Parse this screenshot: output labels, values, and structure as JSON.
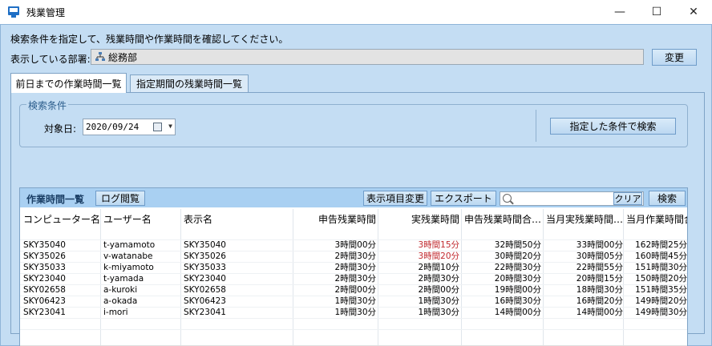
{
  "window": {
    "title": "残業管理",
    "minimize": "—",
    "maximize": "☐",
    "close": "✕"
  },
  "instruction": "検索条件を指定して、残業時間や作業時間を確認してください。",
  "dept": {
    "label": "表示している部署:",
    "value": "総務部",
    "change_button": "変更"
  },
  "tabs": [
    {
      "label": "前日までの作業時間一覧"
    },
    {
      "label": "指定期間の残業時間一覧"
    }
  ],
  "criteria": {
    "legend": "検索条件",
    "date_label": "対象日:",
    "date_value": "2020/09/24",
    "search_button": "指定した条件で検索"
  },
  "list": {
    "title": "作業時間一覧",
    "log_button": "ログ閲覧",
    "display_items_button": "表示項目変更",
    "export_button": "エクスポート",
    "search_placeholder": "",
    "clear_button": "クリア",
    "search_button": "検索",
    "columns": [
      "コンピューター名",
      "ユーザー名",
      "表示名",
      "申告残業時間",
      "実残業時間",
      "申告残業時間合…",
      "当月実残業時間…",
      "当月作業時間合"
    ],
    "rows": [
      [
        "SKY35040",
        "t-yamamoto",
        "SKY35040",
        "3時間00分",
        "3時間15分",
        "32時間50分",
        "33時間00分",
        "162時間25分"
      ],
      [
        "SKY35026",
        "v-watanabe",
        "SKY35026",
        "2時間30分",
        "3時間20分",
        "30時間20分",
        "30時間05分",
        "160時間45分"
      ],
      [
        "SKY35033",
        "k-miyamoto",
        "SKY35033",
        "2時間30分",
        "2時間10分",
        "22時間30分",
        "22時間55分",
        "151時間30分"
      ],
      [
        "SKY23040",
        "t-yamada",
        "SKY23040",
        "2時間30分",
        "2時間30分",
        "20時間30分",
        "20時間15分",
        "150時間20分"
      ],
      [
        "SKY02658",
        "a-kuroki",
        "SKY02658",
        "2時間00分",
        "2時間00分",
        "19時間00分",
        "18時間30分",
        "151時間35分"
      ],
      [
        "SKY06423",
        "a-okada",
        "SKY06423",
        "1時間30分",
        "1時間30分",
        "16時間30分",
        "16時間20分",
        "149時間20分"
      ],
      [
        "SKY23041",
        "i-mori",
        "SKY23041",
        "1時間30分",
        "1時間30分",
        "14時間00分",
        "14時間00分",
        "149時間30分"
      ]
    ],
    "highlight_color": "#c0282d"
  },
  "scroll": {
    "left_arrow": "◀",
    "right_arrow": "▶"
  }
}
